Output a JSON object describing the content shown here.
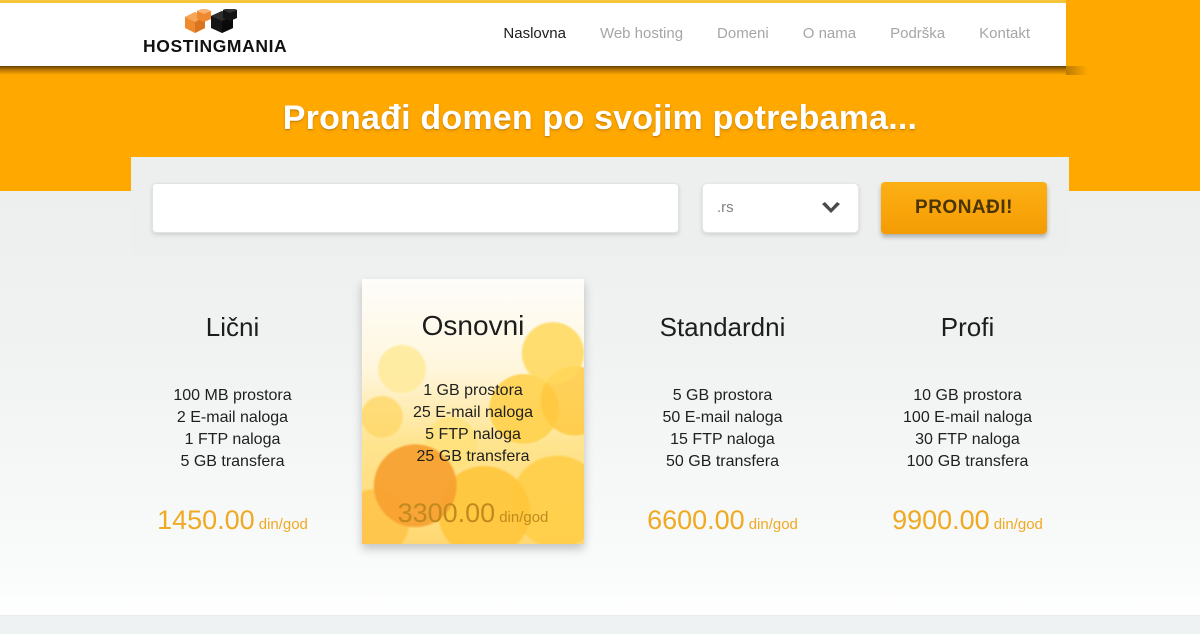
{
  "header": {
    "logo": {
      "text": "HOSTINGMANIA",
      "mark_icon": "blocks-logo-icon",
      "mark_colors": {
        "orange": "#F08A2E",
        "black": "#141414"
      }
    },
    "nav": [
      {
        "label": "Naslovna",
        "active": true
      },
      {
        "label": "Web hosting",
        "active": false
      },
      {
        "label": "Domeni",
        "active": false
      },
      {
        "label": "O nama",
        "active": false
      },
      {
        "label": "Podrška",
        "active": false
      },
      {
        "label": "Kontakt",
        "active": false
      }
    ],
    "accent_top_line": "#F5C43A"
  },
  "hero": {
    "title": "Pronađi domen po svojim potrebama...",
    "background_color": "#FFA800",
    "title_color": "#FFFFFF"
  },
  "search": {
    "panel_background": "#EDEFEF",
    "domain_input": {
      "value": "",
      "placeholder": ""
    },
    "tld_select": {
      "selected": ".rs",
      "chevron_icon": "chevron-down-icon"
    },
    "submit_button": {
      "label": "PRONAĐI!",
      "background_color": "#F9A50A",
      "text_color": "#4A3405"
    }
  },
  "pricing": {
    "plans": [
      {
        "name": "Lični",
        "features": [
          "100 MB prostora",
          "2 E-mail naloga",
          "1 FTP naloga",
          "5 GB transfera"
        ],
        "price": "1450.00",
        "unit": "din/god",
        "featured": false
      },
      {
        "name": "Osnovni",
        "features": [
          "1 GB prostora",
          "25 E-mail naloga",
          "5 FTP naloga",
          "25 GB transfera"
        ],
        "price": "3300.00",
        "unit": "din/god",
        "featured": true
      },
      {
        "name": "Standardni",
        "features": [
          "5 GB prostora",
          "50 E-mail naloga",
          "15 FTP naloga",
          "50 GB transfera"
        ],
        "price": "6600.00",
        "unit": "din/god",
        "featured": false
      },
      {
        "name": "Profi",
        "features": [
          "10 GB prostora",
          "100 E-mail naloga",
          "30 FTP naloga",
          "100 GB transfera"
        ],
        "price": "9900.00",
        "unit": "din/god",
        "featured": false
      }
    ],
    "price_color": "#F0A922",
    "background_color": "#EDEFEF"
  }
}
